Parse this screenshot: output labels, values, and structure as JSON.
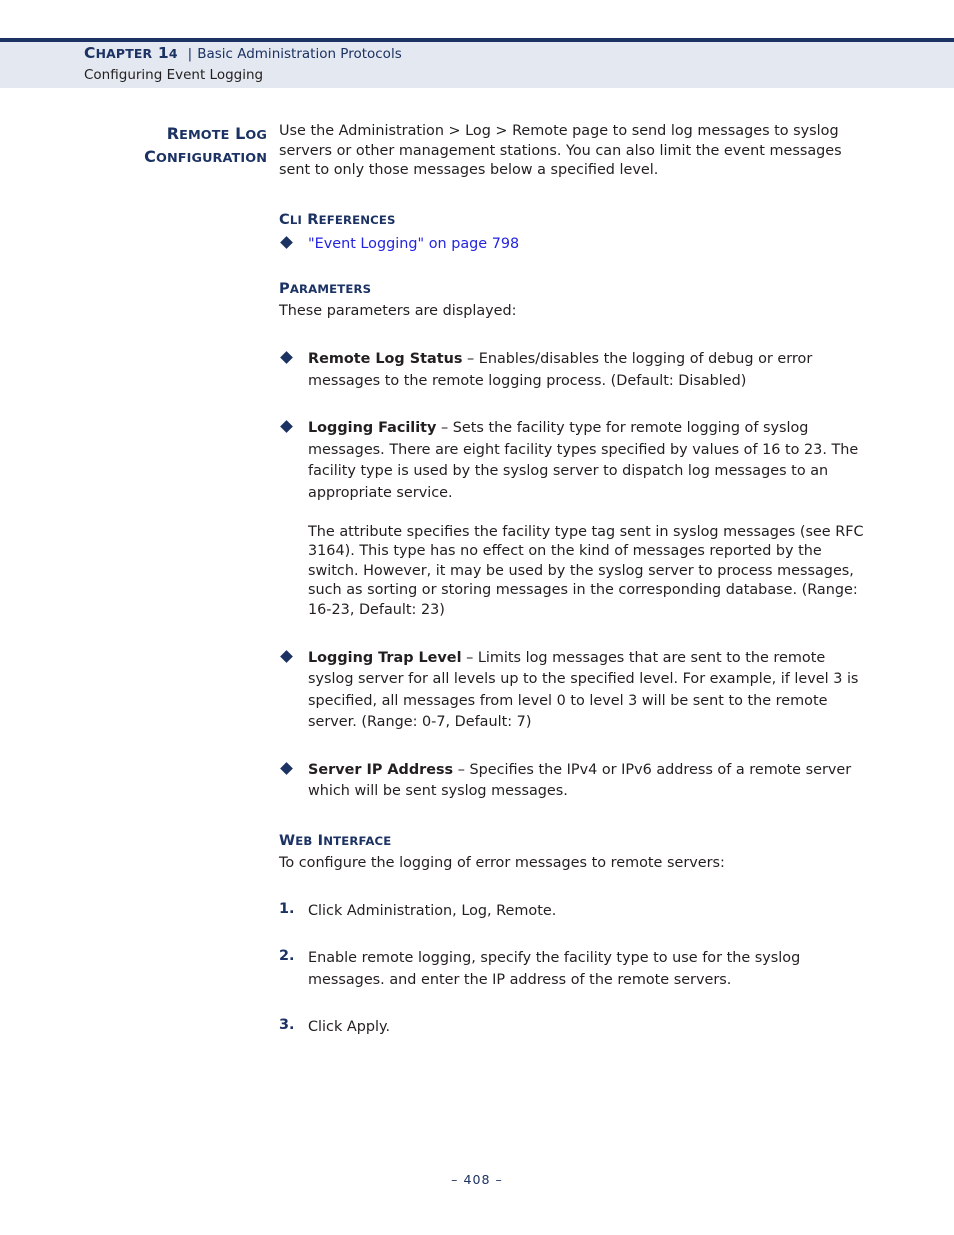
{
  "header": {
    "chapter_label": "CHAPTER 14",
    "separator": "|",
    "chapter_topic": "Basic Administration Protocols",
    "section_title": "Configuring Event Logging"
  },
  "margin_heading": {
    "line1": "REMOTE LOG",
    "line2": "CONFIGURATION"
  },
  "intro": {
    "paragraph": "Use the Administration > Log > Remote page to send log messages to syslog servers or other management stations. You can also limit the event messages sent to only those messages below a specified level."
  },
  "cli_references": {
    "label": "CLI REFERENCES",
    "items": [
      {
        "bullet": "diamond",
        "text": "\"Event Logging\" on page 798"
      }
    ]
  },
  "parameters": {
    "label": "PARAMETERS",
    "intro": "These parameters are displayed:",
    "items": [
      {
        "term": "Remote Log Status",
        "dash": "–",
        "description": "Enables/disables the logging of debug or error messages to the remote logging process. (Default: Disabled)"
      },
      {
        "term": "Logging Facility",
        "dash": "–",
        "description": "Sets the facility type for remote logging of syslog messages. There are eight facility types specified by values of 16 to 23. The facility type is used by the syslog server to dispatch log messages to an appropriate service.",
        "extra_paragraph": "The attribute specifies the facility type tag sent in syslog messages (see RFC 3164). This type has no effect on the kind of messages reported by the switch. However, it may be used by the syslog server to process messages, such as sorting or storing messages in the corresponding database. (Range: 16-23, Default: 23)"
      },
      {
        "term": "Logging Trap Level",
        "dash": "–",
        "description": "Limits log messages that are sent to the remote syslog server for all levels up to the specified level. For example, if level 3 is specified, all messages from level 0 to level 3 will be sent to the remote server. (Range: 0-7, Default: 7)"
      },
      {
        "term": "Server IP Address",
        "dash": "–",
        "description": "Specifies the IPv4 or IPv6 address of a remote server which will be sent syslog messages."
      }
    ]
  },
  "web_interface": {
    "label": "WEB INTERFACE",
    "intro": "To configure the logging of error messages to remote servers:",
    "steps": [
      {
        "number": "1.",
        "text": "Click Administration, Log, Remote."
      },
      {
        "number": "2.",
        "text": "Enable remote logging, specify the facility type to use for the syslog messages. and enter the IP address of the remote servers."
      },
      {
        "number": "3.",
        "text": "Click Apply."
      }
    ]
  },
  "footer": {
    "page_number": "–   408   –"
  },
  "colors": {
    "navy": "#1b3263",
    "header_band": "#e4e8f0",
    "link_blue": "#2424e0",
    "body_text": "#231f20"
  }
}
